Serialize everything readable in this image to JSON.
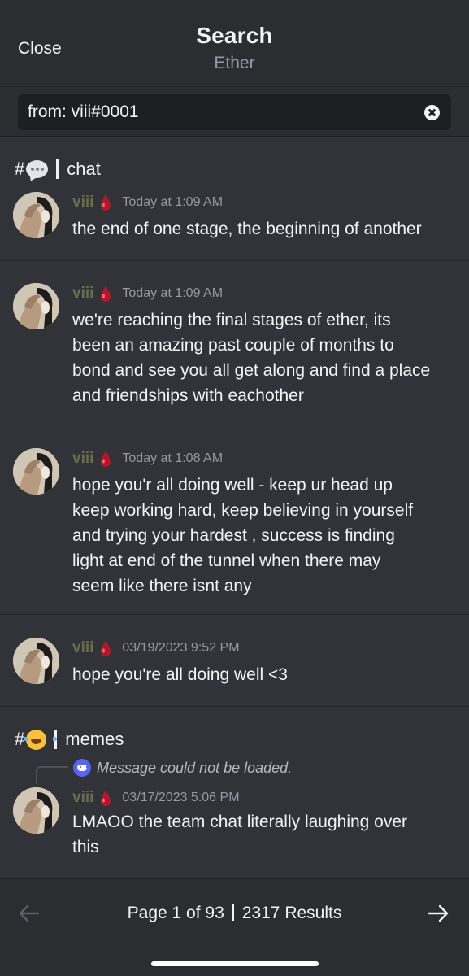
{
  "header": {
    "close_label": "Close",
    "title": "Search",
    "subtitle": "Ether"
  },
  "search": {
    "query": "from: viii#0001"
  },
  "channels": [
    {
      "hash": "#",
      "emoji": "speech-bubble-emoji",
      "name": "chat"
    },
    {
      "hash": "#",
      "emoji": "tears-of-joy-emoji",
      "name": "memes"
    }
  ],
  "messages": [
    {
      "author": "viii",
      "timestamp": "Today at 1:09 AM",
      "lines": [
        "the end of one stage, the beginning of another"
      ]
    },
    {
      "author": "viii",
      "timestamp": "Today at 1:09 AM",
      "lines": [
        "we're reaching the final stages of ether, its",
        "been an amazing past couple of months to",
        "bond and see you all get along and find a place",
        "and friendships with eachother"
      ]
    },
    {
      "author": "viii",
      "timestamp": "Today at 1:08 AM",
      "lines": [
        "hope you'r all doing well - keep ur head up",
        "keep working hard, keep believing in yourself",
        "and trying your hardest , success is finding",
        "light at end of the tunnel when there may",
        "seem like there isnt any"
      ]
    },
    {
      "author": "viii",
      "timestamp": "03/19/2023 9:52 PM",
      "lines": [
        "hope you're all doing well <3"
      ]
    },
    {
      "author": "viii",
      "timestamp": "03/17/2023 5:06 PM",
      "reply_text": "Message could not be loaded.",
      "lines": [
        "LMAOO the team chat literally laughing over",
        "this"
      ]
    }
  ],
  "footer": {
    "page_text": "Page 1 of 93",
    "results_text": "2317 Results"
  },
  "colors": {
    "background": "#313338",
    "header": "#2b2d31",
    "author": "#6a6d4f",
    "drop_icon": "#c0392b",
    "reply_icon": "#5865f2"
  }
}
